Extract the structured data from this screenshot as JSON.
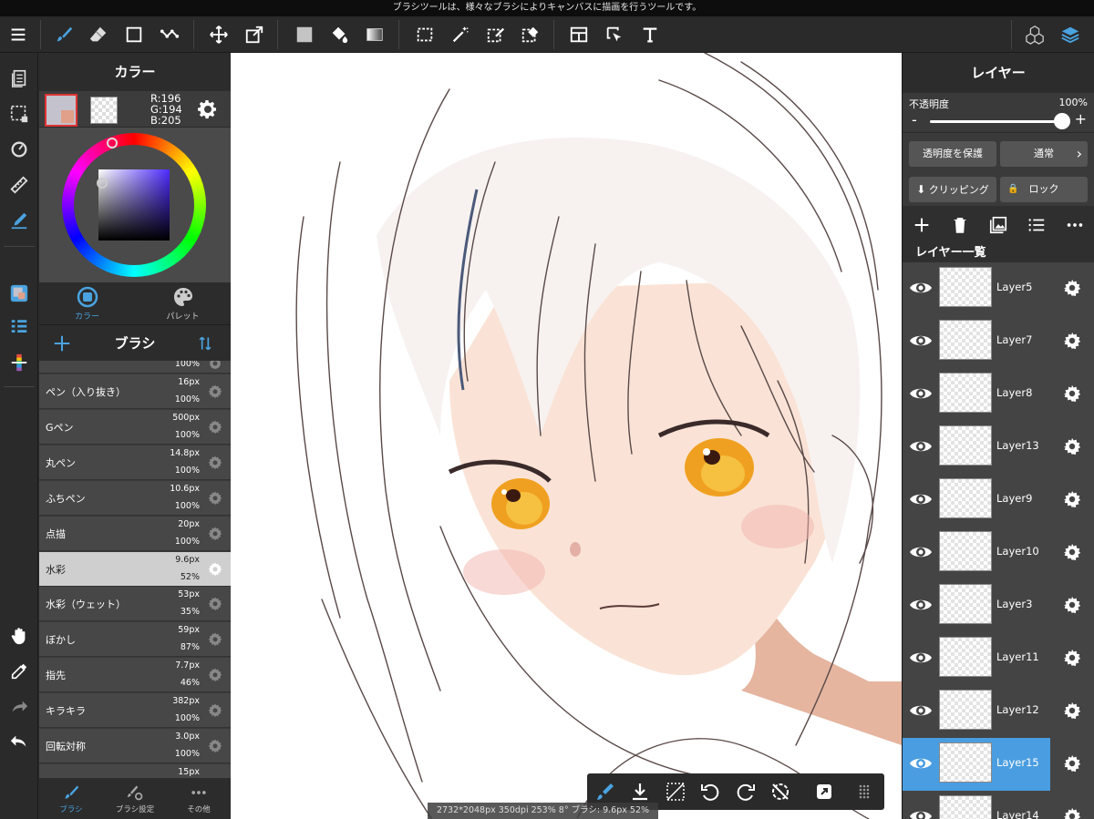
{
  "hint": "ブラシツールは、様々なブラシによりキャンバスに描画を行うツールです。",
  "colors": {
    "accent": "#4aa3e0",
    "selected_layer": "#4a9de0",
    "main_color": "#c4c2cd"
  },
  "color_panel": {
    "title": "カラー",
    "r": "R:196",
    "g": "G:194",
    "b": "B:205",
    "tabs": [
      {
        "label": "カラー",
        "icon": "color-icon"
      },
      {
        "label": "パレット",
        "icon": "palette-icon"
      }
    ]
  },
  "brush_panel": {
    "title": "ブラシ",
    "partial_top_opacity": "100%",
    "brushes": [
      {
        "name": "ペン（入り抜き）",
        "size": "16px",
        "opacity": "100%"
      },
      {
        "name": "Gペン",
        "size": "500px",
        "opacity": "100%"
      },
      {
        "name": "丸ペン",
        "size": "14.8px",
        "opacity": "100%"
      },
      {
        "name": "ふちペン",
        "size": "10.6px",
        "opacity": "100%"
      },
      {
        "name": "点描",
        "size": "20px",
        "opacity": "100%"
      },
      {
        "name": "水彩",
        "size": "9.6px",
        "opacity": "52%",
        "selected": true
      },
      {
        "name": "水彩（ウェット）",
        "size": "53px",
        "opacity": "35%"
      },
      {
        "name": "ぼかし",
        "size": "59px",
        "opacity": "87%"
      },
      {
        "name": "指先",
        "size": "7.7px",
        "opacity": "46%"
      },
      {
        "name": "キラキラ",
        "size": "382px",
        "opacity": "100%"
      },
      {
        "name": "回転対称",
        "size": "3.0px",
        "opacity": "100%"
      }
    ],
    "partial_bottom_size": "15px",
    "tabs": [
      {
        "label": "ブラシ",
        "icon": "brush-icon"
      },
      {
        "label": "ブラシ設定",
        "icon": "brush-settings-icon"
      },
      {
        "label": "その他",
        "icon": "more-icon"
      }
    ]
  },
  "status": "2732*2048px 350dpi 253% 8° ブラシ: 9.6px 52%",
  "layer_panel": {
    "title": "レイヤー",
    "opacity_label": "不透明度",
    "opacity_value": "100%",
    "opacity_fraction": 1.0,
    "protect_label": "透明度を保護",
    "blend_label": "通常",
    "clipping_label": "クリッピング",
    "lock_label": "ロック",
    "list_title": "レイヤー一覧",
    "layers": [
      {
        "name": "Layer5"
      },
      {
        "name": "Layer7"
      },
      {
        "name": "Layer8"
      },
      {
        "name": "Layer13"
      },
      {
        "name": "Layer9"
      },
      {
        "name": "Layer10"
      },
      {
        "name": "Layer3"
      },
      {
        "name": "Layer11"
      },
      {
        "name": "Layer12"
      },
      {
        "name": "Layer15",
        "selected": true
      },
      {
        "name": "Layer14"
      }
    ]
  }
}
